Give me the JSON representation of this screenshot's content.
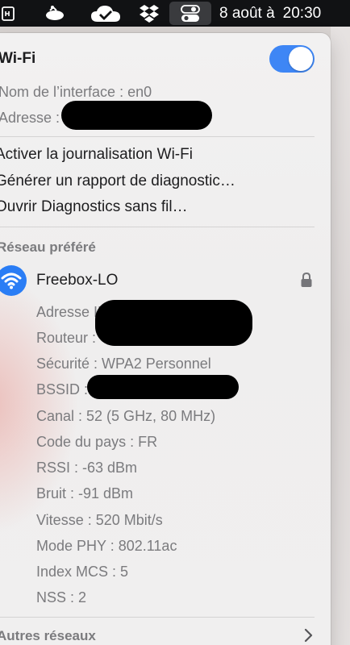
{
  "menubar": {
    "date": "8 août à",
    "time": "20:30",
    "icons": [
      "app-icon",
      "satellite-icon",
      "icloud-sync-icon",
      "dropbox-icon",
      "control-center-icon"
    ]
  },
  "wifi": {
    "title": "Wi-Fi",
    "enabled": true,
    "interface_label": "Nom de l’interface :",
    "interface_value": "en0",
    "address_label": "Adresse :"
  },
  "actions": [
    "Activer la journalisation Wi-Fi",
    "Générer un rapport de diagnostic…",
    "Ouvrir Diagnostics sans fil…"
  ],
  "preferred": {
    "section_title": "Réseau préféré",
    "network_name": "Freebox-LO",
    "details": {
      "ip_label": "Adresse IP :",
      "router_label": "Routeur :",
      "security": "Sécurité : WPA2 Personnel",
      "bssid_label": "BSSID :",
      "channel": "Canal : 52 (5 GHz, 80 MHz)",
      "country": "Code du pays : FR",
      "rssi": "RSSI : -63 dBm",
      "noise": "Bruit : -91 dBm",
      "speed": "Vitesse : 520 Mbit/s",
      "phy": "Mode PHY : 802.11ac",
      "mcs": "Index MCS : 5",
      "nss": "NSS : 2"
    }
  },
  "other_networks": "Autres réseaux",
  "colors": {
    "accent": "#3e86f5",
    "menubar": "#111214"
  }
}
